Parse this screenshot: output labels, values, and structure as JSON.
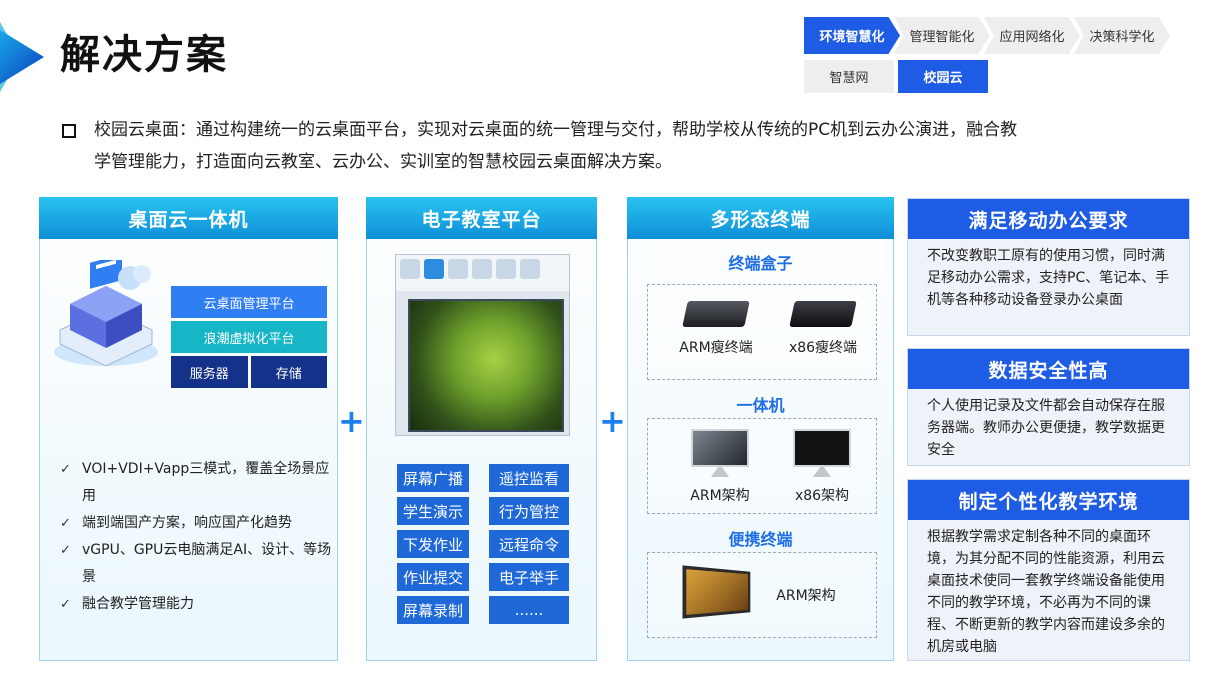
{
  "header": {
    "title": "解决方案",
    "steps": [
      "环境智慧化",
      "管理智能化",
      "应用网络化",
      "决策科学化"
    ],
    "active_step": 0,
    "subtabs": [
      "智慧网",
      "校园云"
    ],
    "active_subtab": 1
  },
  "intro": {
    "line1": "校园云桌面：通过构建统一的云桌面平台，实现对云桌面的统一管理与交付，帮助学校从传统的PC机到云办公演进，融合教",
    "line2": "学管理能力，打造面向云教室、云办公、实训室的智慧校园云桌面解决方案。"
  },
  "panel1": {
    "title": "桌面云一体机",
    "stack": {
      "row1": "云桌面管理平台",
      "row2": "浪潮虚拟化平台",
      "row3_left": "服务器",
      "row3_right": "存储"
    },
    "features": [
      "VOI+VDI+Vapp三模式，覆盖全场景应用",
      "端到端国产方案，响应国产化趋势",
      "vGPU、GPU云电脑满足AI、设计、等场景",
      "融合教学管理能力"
    ]
  },
  "panel2": {
    "title": "电子教室平台",
    "buttons": [
      "屏幕广播",
      "遥控监看",
      "学生演示",
      "行为管控",
      "下发作业",
      "远程命令",
      "作业提交",
      "电子举手",
      "屏幕录制",
      "......"
    ]
  },
  "panel3": {
    "title": "多形态终端",
    "groups": [
      {
        "title": "终端盒子",
        "items": [
          "ARM瘦终端",
          "x86瘦终端"
        ]
      },
      {
        "title": "一体机",
        "items": [
          "ARM架构",
          "x86架构"
        ]
      },
      {
        "title": "便携终端",
        "items": [
          "ARM架构"
        ]
      }
    ]
  },
  "cards": [
    {
      "title": "满足移动办公要求",
      "body": "不改变教职工原有的使用习惯，同时满足移动办公需求，支持PC、笔记本、手机等各种移动设备登录办公桌面"
    },
    {
      "title": "数据安全性高",
      "body": "个人使用记录及文件都会自动保存在服务器端。教师办公更便捷，教学数据更安全"
    },
    {
      "title": "制定个性化教学环境",
      "body": "根据教学需求定制各种不同的桌面环境，为其分配不同的性能资源，利用云桌面技术使同一套教学终端设备能使用不同的教学环境，不必再为不同的课程、不断更新的教学内容而建设多余的机房或电脑"
    }
  ],
  "plus_sign": "+",
  "colors": {
    "accent": "#1e5ce6",
    "cyan": "#17b6c7",
    "navy": "#14328a"
  }
}
